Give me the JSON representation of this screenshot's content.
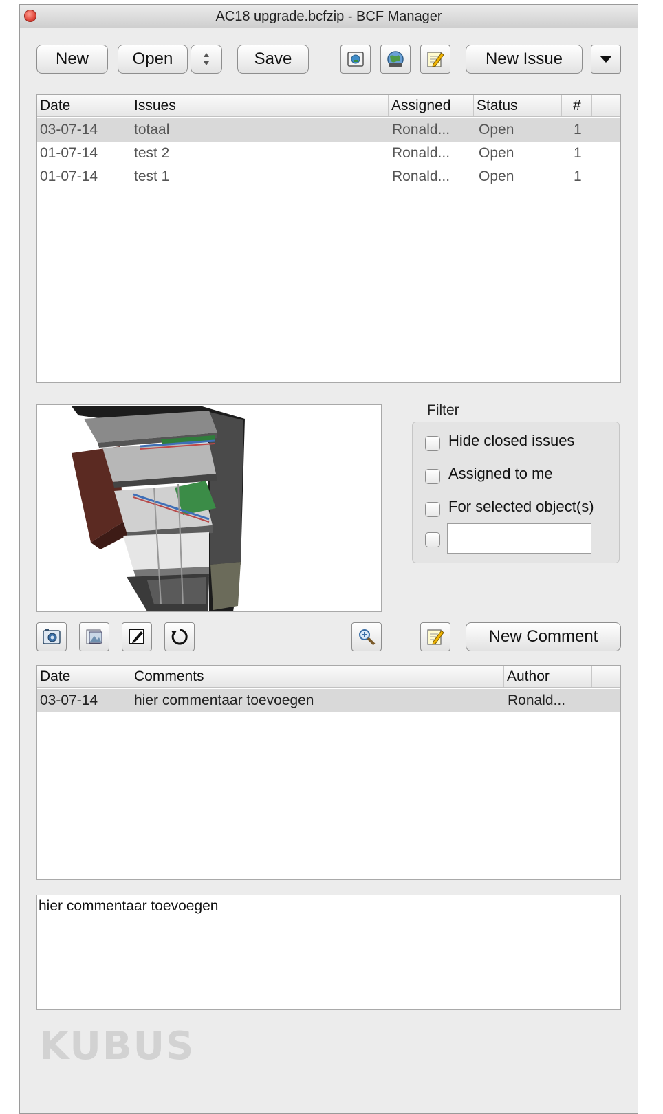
{
  "window": {
    "title": "AC18 upgrade.bcfzip - BCF Manager"
  },
  "toolbar": {
    "new_label": "New",
    "open_label": "Open",
    "open_stepper_glyph": "↕",
    "save_label": "Save",
    "new_issue_label": "New Issue",
    "icons": [
      "viewpoint-icon",
      "globe-icon",
      "edit-note-icon",
      "dropdown-arrow-icon"
    ]
  },
  "issues": {
    "columns": [
      "Date",
      "Issues",
      "Assigned",
      "Status",
      "#"
    ],
    "rows": [
      {
        "date": "03-07-14",
        "issue": "totaal",
        "assigned": "Ronald...",
        "status": "Open",
        "count": "1"
      },
      {
        "date": "01-07-14",
        "issue": "test 2",
        "assigned": "Ronald...",
        "status": "Open",
        "count": "1"
      },
      {
        "date": "01-07-14",
        "issue": "test 1",
        "assigned": "Ronald...",
        "status": "Open",
        "count": "1"
      }
    ]
  },
  "filter": {
    "title": "Filter",
    "hide_closed": "Hide closed issues",
    "assigned_to_me": "Assigned to me",
    "for_selected": "For selected object(s)",
    "custom_value": ""
  },
  "comment_toolbar": {
    "new_comment_label": "New Comment",
    "icons": [
      "camera-icon",
      "folder-image-icon",
      "pencil-icon",
      "refresh-icon",
      "zoom-icon",
      "edit-note-icon"
    ]
  },
  "comments": {
    "columns": [
      "Date",
      "Comments",
      "Author"
    ],
    "rows": [
      {
        "date": "03-07-14",
        "comment": "hier commentaar toevoegen",
        "author": "Ronald..."
      }
    ]
  },
  "comment_editor": {
    "value": "hier commentaar toevoegen"
  },
  "logo": {
    "text": "KUBUS"
  },
  "colors": {
    "selected_row": "#d9d9d9",
    "window_bg": "#ececec",
    "close_button": "#e0463a"
  }
}
